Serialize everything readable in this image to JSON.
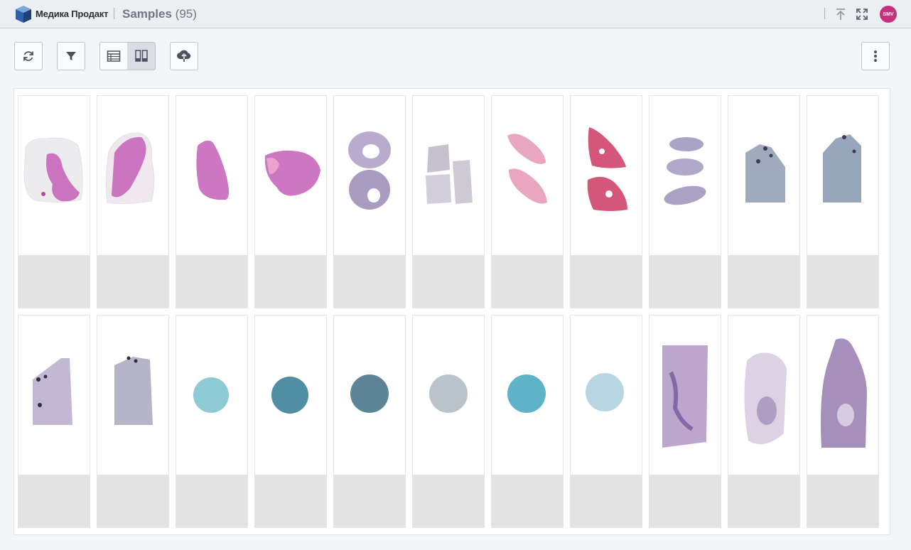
{
  "header": {
    "brand": "Медика Продакт",
    "title": "Samples",
    "count": "(95)",
    "avatar_initials": "SMV",
    "avatar_color": "#c8327a",
    "icons": [
      "logo-cube-icon",
      "scroll-top-icon",
      "fullscreen-icon"
    ]
  },
  "toolbar": {
    "buttons": [
      "refresh-icon",
      "filter-icon",
      "table-view-icon",
      "gallery-view-icon",
      "upload-icon",
      "more-vertical-icon"
    ],
    "active_view": "gallery"
  },
  "colors": {
    "accent": "#c8327a",
    "label_strip": "#e3e3e3",
    "he_stain": "#c45fb7",
    "purple_stain": "#8b6fa8",
    "red_stain": "#cc3a62",
    "teal_stain": "#5fb3c9"
  },
  "samples": [
    {
      "stain": "he-lung"
    },
    {
      "stain": "he-tissue"
    },
    {
      "stain": "he-tissue"
    },
    {
      "stain": "he-tissue"
    },
    {
      "stain": "purple-rings"
    },
    {
      "stain": "grey-blocks"
    },
    {
      "stain": "pink-strips"
    },
    {
      "stain": "red-triangles"
    },
    {
      "stain": "purple-strips"
    },
    {
      "stain": "blue-rect"
    },
    {
      "stain": "blue-rect"
    },
    {
      "stain": "blue-rect-dark"
    },
    {
      "stain": "blue-rect-dark"
    },
    {
      "stain": "teal-dot"
    },
    {
      "stain": "dark-teal-dot"
    },
    {
      "stain": "dark-teal-dot"
    },
    {
      "stain": "grey-dot"
    },
    {
      "stain": "teal-dot"
    },
    {
      "stain": "light-dot"
    },
    {
      "stain": "purple-slab"
    },
    {
      "stain": "light-slab"
    },
    {
      "stain": "purple-slab"
    }
  ]
}
